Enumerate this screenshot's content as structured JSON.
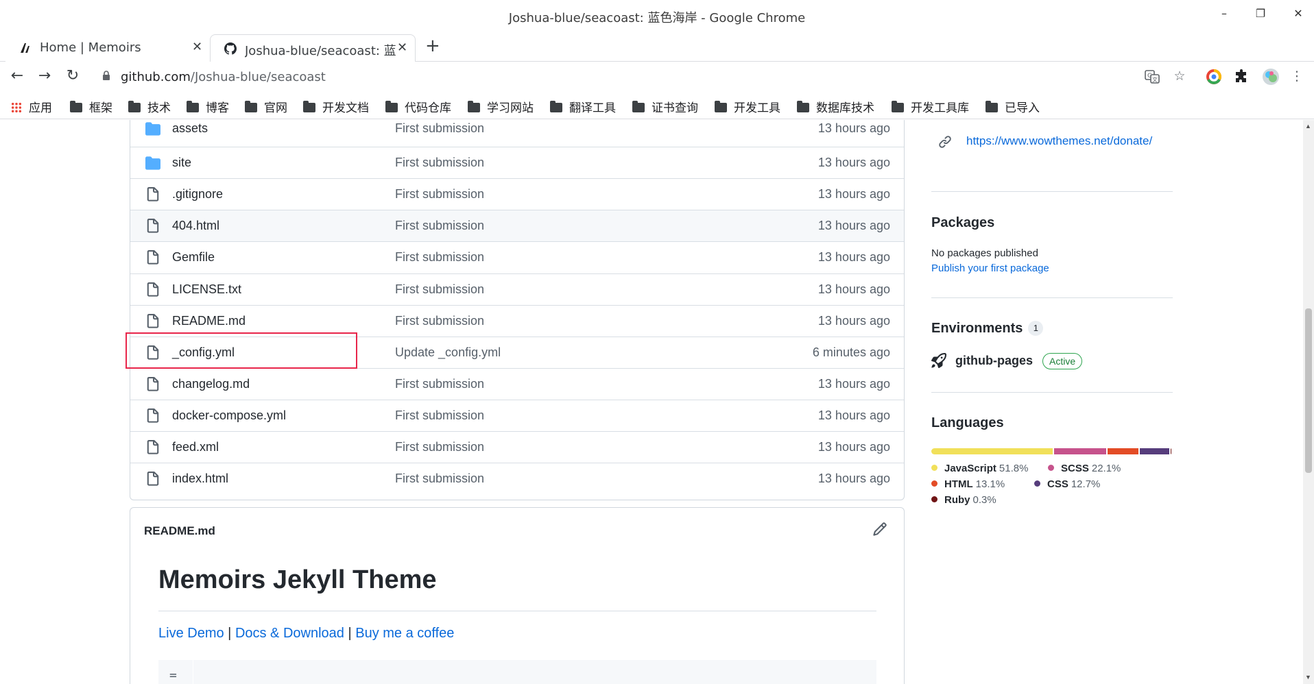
{
  "window": {
    "title": "Joshua-blue/seacoast: 蓝色海岸 - Google Chrome",
    "controls": {
      "minimize": "–",
      "restore": "❐",
      "close": "✕"
    }
  },
  "tabs": [
    {
      "label": "Home | Memoirs",
      "icon": "memoirs-logo-icon",
      "close": "✕"
    },
    {
      "label": "Joshua-blue/seacoast: 蓝色",
      "icon": "github-icon",
      "close": "✕"
    }
  ],
  "new_tab": "+",
  "toolbar": {
    "back": "←",
    "forward": "→",
    "reload": "↻",
    "url_host": "github.com",
    "url_path": "/Joshua-blue/seacoast",
    "icons": [
      "translate-icon",
      "star-icon",
      "chrome-extension-icon",
      "puzzle-icon",
      "profile-avatar-icon",
      "kebab-menu-icon"
    ]
  },
  "bookmarks": [
    {
      "label": "应用",
      "type": "apps"
    },
    {
      "label": "框架",
      "type": "folder"
    },
    {
      "label": "技术",
      "type": "folder"
    },
    {
      "label": "博客",
      "type": "folder"
    },
    {
      "label": "官网",
      "type": "folder"
    },
    {
      "label": "开发文档",
      "type": "folder"
    },
    {
      "label": "代码仓库",
      "type": "folder"
    },
    {
      "label": "学习网站",
      "type": "folder"
    },
    {
      "label": "翻译工具",
      "type": "folder"
    },
    {
      "label": "证书查询",
      "type": "folder"
    },
    {
      "label": "开发工具",
      "type": "folder"
    },
    {
      "label": "数据库技术",
      "type": "folder"
    },
    {
      "label": "开发工具库",
      "type": "folder"
    },
    {
      "label": "已导入",
      "type": "folder"
    }
  ],
  "files": [
    {
      "name": "assets",
      "type": "dir",
      "message": "First submission",
      "age": "13 hours ago"
    },
    {
      "name": "site",
      "type": "dir",
      "message": "First submission",
      "age": "13 hours ago"
    },
    {
      "name": ".gitignore",
      "type": "file",
      "message": "First submission",
      "age": "13 hours ago"
    },
    {
      "name": "404.html",
      "type": "file",
      "message": "First submission",
      "age": "13 hours ago"
    },
    {
      "name": "Gemfile",
      "type": "file",
      "message": "First submission",
      "age": "13 hours ago"
    },
    {
      "name": "LICENSE.txt",
      "type": "file",
      "message": "First submission",
      "age": "13 hours ago"
    },
    {
      "name": "README.md",
      "type": "file",
      "message": "First submission",
      "age": "13 hours ago"
    },
    {
      "name": "_config.yml",
      "type": "file",
      "message": "Update _config.yml",
      "age": "6 minutes ago"
    },
    {
      "name": "changelog.md",
      "type": "file",
      "message": "First submission",
      "age": "13 hours ago"
    },
    {
      "name": "docker-compose.yml",
      "type": "file",
      "message": "First submission",
      "age": "13 hours ago"
    },
    {
      "name": "feed.xml",
      "type": "file",
      "message": "First submission",
      "age": "13 hours ago"
    },
    {
      "name": "index.html",
      "type": "file",
      "message": "First submission",
      "age": "13 hours ago"
    }
  ],
  "readme": {
    "filename": "README.md",
    "heading": "Memoirs Jekyll Theme",
    "links": [
      "Live Demo",
      "Docs & Download",
      "Buy me a coffee"
    ],
    "separator": "|",
    "code_first_char": "="
  },
  "sidebar": {
    "website": "https://www.wowthemes.net/donate/",
    "packages": {
      "heading": "Packages",
      "empty_text": "No packages published",
      "publish_link": "Publish your first package"
    },
    "environments": {
      "heading": "Environments",
      "count": "1",
      "name": "github-pages",
      "status": "Active"
    },
    "languages": {
      "heading": "Languages",
      "items": [
        {
          "name": "JavaScript",
          "percent": "51.8%",
          "value": 51.8,
          "color": "#f1e05a"
        },
        {
          "name": "SCSS",
          "percent": "22.1%",
          "value": 22.1,
          "color": "#c6538c"
        },
        {
          "name": "HTML",
          "percent": "13.1%",
          "value": 13.1,
          "color": "#e34c26"
        },
        {
          "name": "CSS",
          "percent": "12.7%",
          "value": 12.7,
          "color": "#563d7c"
        },
        {
          "name": "Ruby",
          "percent": "0.3%",
          "value": 0.3,
          "color": "#701516"
        }
      ]
    }
  }
}
